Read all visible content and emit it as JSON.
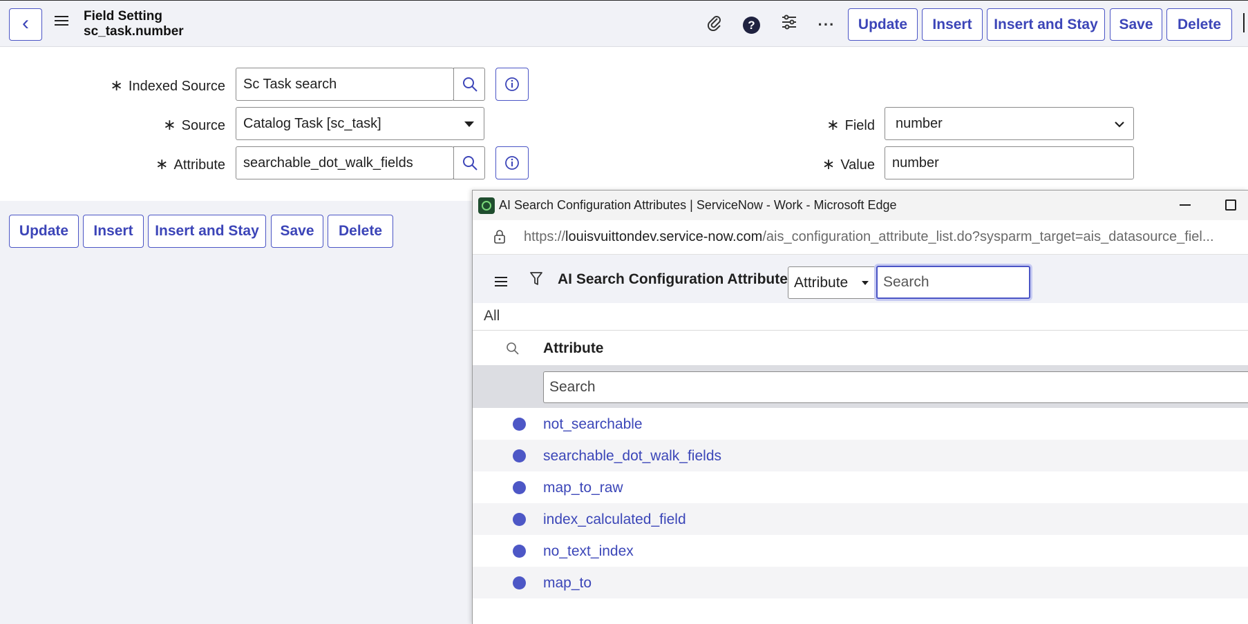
{
  "header": {
    "title": "Field Setting",
    "subtitle": "sc_task.number",
    "buttons": [
      "Update",
      "Insert",
      "Insert and Stay",
      "Save",
      "Delete"
    ]
  },
  "form": {
    "indexed_source": {
      "label": "Indexed Source",
      "value": "Sc Task search"
    },
    "source": {
      "label": "Source",
      "value": "Catalog Task [sc_task]"
    },
    "attribute": {
      "label": "Attribute",
      "value": "searchable_dot_walk_fields"
    },
    "field": {
      "label": "Field",
      "value": "number"
    },
    "value": {
      "label": "Value",
      "value": "number"
    },
    "required_marker": "∗"
  },
  "bottom_buttons": [
    "Update",
    "Insert",
    "Insert and Stay",
    "Save",
    "Delete"
  ],
  "popup": {
    "window_title": "AI Search Configuration Attributes | ServiceNow - Work - Microsoft Edge",
    "url_prefix": "https://",
    "url_host": "louisvuittondev.service-now.com",
    "url_path": "/ais_configuration_attribute_list.do?sysparm_target=ais_datasource_fiel...",
    "list_title": "AI Search Configuration Attributes",
    "search_field_select": "Attribute",
    "search_placeholder": "Search",
    "breadcrumb": "All",
    "column_header": "Attribute",
    "column_search_placeholder": "Search",
    "rows": [
      "not_searchable",
      "searchable_dot_walk_fields",
      "map_to_raw",
      "index_calculated_field",
      "no_text_index",
      "map_to"
    ]
  },
  "colors": {
    "accent": "#3c45b8",
    "header_bg": "#f1f2f7",
    "row_dot": "#4d57c6"
  },
  "icons": [
    "back-icon",
    "menu-icon",
    "attachment-icon",
    "help-icon",
    "settings-icon",
    "more-icon",
    "search-icon",
    "info-icon",
    "filter-icon",
    "lock-icon"
  ]
}
